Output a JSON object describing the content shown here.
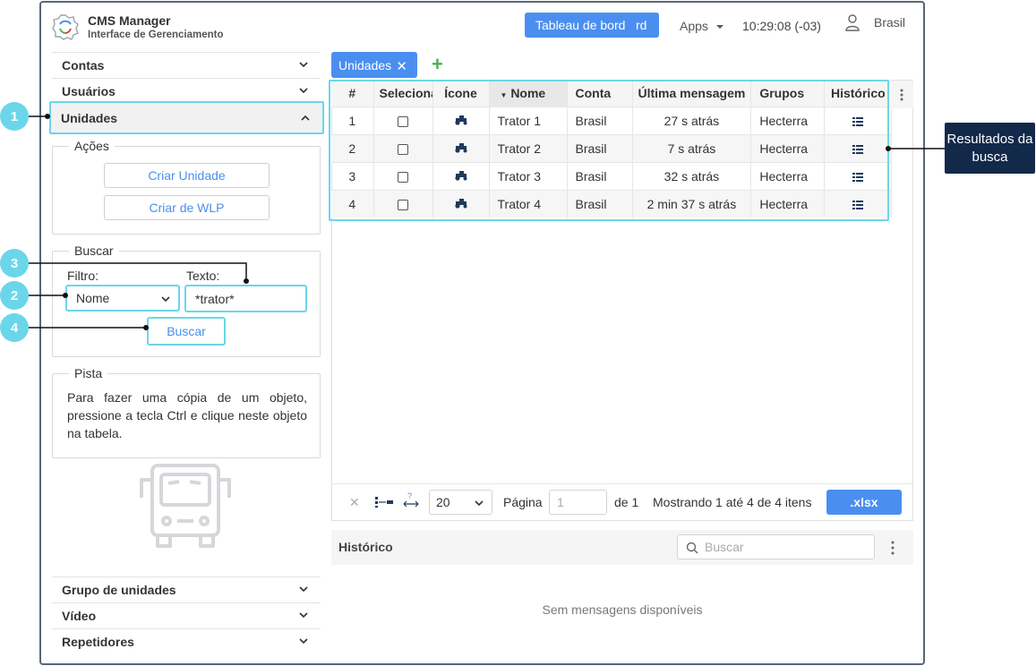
{
  "header": {
    "app_title": "CMS Manager",
    "app_subtitle": "Interface de Gerenciamento",
    "dashboard_label": "Tableau de bord",
    "dashboard_suffix": "rd",
    "apps_label": "Apps",
    "clock": "10:29:08 (-03)",
    "user_name": "Brasil"
  },
  "sidebar": {
    "items_top": [
      {
        "label": "Contas"
      },
      {
        "label": "Usuários"
      },
      {
        "label": "Unidades"
      }
    ],
    "actions": {
      "legend": "Ações",
      "create_unit": "Criar Unidade",
      "create_wlp": "Criar de WLP"
    },
    "search": {
      "legend": "Buscar",
      "filter_label": "Filtro:",
      "text_label": "Texto:",
      "filter_value": "Nome",
      "text_value": "*trator*",
      "button": "Buscar"
    },
    "hint": {
      "legend": "Pista",
      "text": "Para fazer uma cópia de um objeto, pressione a tecla Ctrl e clique neste objeto na tabela."
    },
    "items_bottom": [
      {
        "label": "Grupo de unidades"
      },
      {
        "label": "Vídeo"
      },
      {
        "label": "Repetidores"
      }
    ]
  },
  "tabs": [
    {
      "label": "Unidades"
    }
  ],
  "table": {
    "columns": [
      "#",
      "Seleciona",
      "Ícone",
      "Nome",
      "Conta",
      "Última mensagem",
      "Grupos",
      "Histórico"
    ],
    "rows": [
      {
        "num": "1",
        "name": "Trator 1",
        "account": "Brasil",
        "last_msg": "27 s atrás",
        "groups": "Hecterra"
      },
      {
        "num": "2",
        "name": "Trator 2",
        "account": "Brasil",
        "last_msg": "7 s atrás",
        "groups": "Hecterra"
      },
      {
        "num": "3",
        "name": "Trator 3",
        "account": "Brasil",
        "last_msg": "32 s atrás",
        "groups": "Hecterra"
      },
      {
        "num": "4",
        "name": "Trator 4",
        "account": "Brasil",
        "last_msg": "2 min 37 s atrás",
        "groups": "Hecterra"
      }
    ]
  },
  "pager": {
    "page_size": "20",
    "page_label": "Página",
    "page_placeholder": "1",
    "of_label": "de 1",
    "showing": "Mostrando 1 até 4 de 4 itens",
    "export": ".xlsx"
  },
  "history": {
    "title": "Histórico",
    "search_placeholder": "Buscar",
    "empty": "Sem mensagens disponíveis"
  },
  "annotations": {
    "badges": [
      "1",
      "2",
      "3",
      "4"
    ],
    "callout": "Resultados da busca",
    "color": "#6bd6ea",
    "callout_color": "#12294a"
  },
  "colors": {
    "primary": "#4a8ff0",
    "add": "#4caf50",
    "frame": "#5a6577"
  }
}
